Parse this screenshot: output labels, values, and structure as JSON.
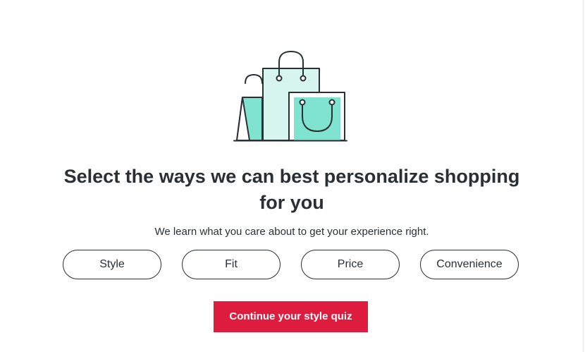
{
  "illustration": {
    "icon": "shopping-bags-icon",
    "colors": {
      "outline": "#2a2f33",
      "light_fill": "#d7f5ef",
      "teal_fill": "#7fe3cf"
    }
  },
  "headline": {
    "line1": "Select the ways we can best personalize shopping",
    "line2": "for you"
  },
  "subtitle": "We learn what you care about to get your experience right.",
  "options": [
    {
      "label": "Style"
    },
    {
      "label": "Fit"
    },
    {
      "label": "Price"
    },
    {
      "label": "Convenience"
    }
  ],
  "cta": {
    "label": "Continue your style quiz",
    "color": "#de1c3e"
  }
}
